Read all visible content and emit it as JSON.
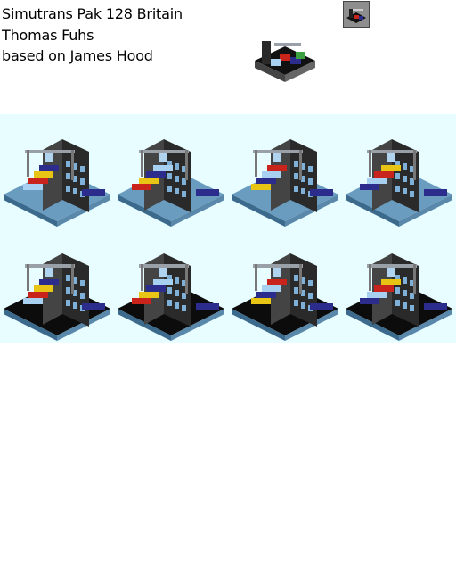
{
  "credits": {
    "line1": "Simutrans Pak 128 Britain",
    "line2": "Thomas Fuhs",
    "line3": "based on James Hood"
  },
  "icons": {
    "menu_icon": "container-terminal-icon",
    "preview": "container-terminal-preview"
  },
  "sprites": [
    {
      "name": "terminal-view-1",
      "row": 0,
      "col": 0
    },
    {
      "name": "terminal-view-2",
      "row": 0,
      "col": 1
    },
    {
      "name": "terminal-view-3",
      "row": 0,
      "col": 2
    },
    {
      "name": "terminal-view-4",
      "row": 0,
      "col": 3
    },
    {
      "name": "terminal-view-5",
      "row": 1,
      "col": 0
    },
    {
      "name": "terminal-view-6",
      "row": 1,
      "col": 1
    },
    {
      "name": "terminal-view-7",
      "row": 1,
      "col": 2
    },
    {
      "name": "terminal-view-8",
      "row": 1,
      "col": 3
    }
  ],
  "colors": {
    "sheet_bg": "#e8fdff",
    "building": "#2a2a2a",
    "window": "#7fb0d8",
    "crane": "#9aa0a8",
    "container_red": "#c8241c",
    "container_yellow": "#e8c414",
    "container_blue": "#2c2c8c",
    "container_light": "#a8d0f0",
    "quay": "#6a9cc0"
  }
}
